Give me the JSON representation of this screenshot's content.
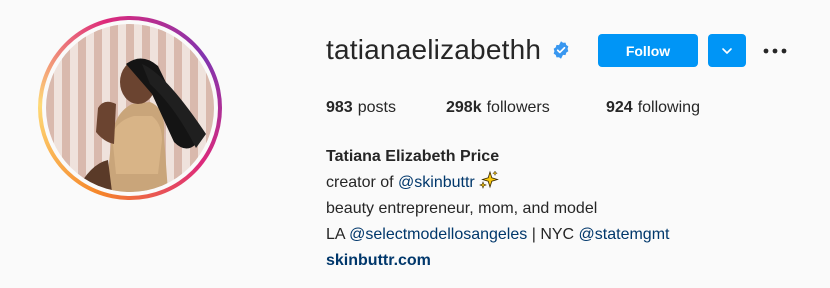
{
  "profile": {
    "username": "tatianaelizabethh",
    "verified": true,
    "follow_label": "Follow",
    "stats": {
      "posts_count": "983",
      "posts_label": "posts",
      "followers_count": "298k",
      "followers_label": "followers",
      "following_count": "924",
      "following_label": "following"
    },
    "bio": {
      "full_name": "Tatiana Elizabeth Price",
      "line1_prefix": "creator of ",
      "line1_mention": "@skinbuttr",
      "line1_emoji": "sparkles-emoji",
      "line2": "beauty entrepreneur, mom, and model",
      "line3_prefix": "LA ",
      "line3_mention1": "@selectmodellosangeles",
      "line3_sep": " | NYC ",
      "line3_mention2": "@statemgmt",
      "website": "skinbuttr.com"
    }
  },
  "colors": {
    "accent": "#0095f6",
    "link": "#00376b",
    "text": "#262626",
    "background": "#fafafa"
  },
  "icons": {
    "verified": "verified-badge-icon",
    "dropdown": "chevron-down-icon",
    "more": "more-options-icon"
  }
}
